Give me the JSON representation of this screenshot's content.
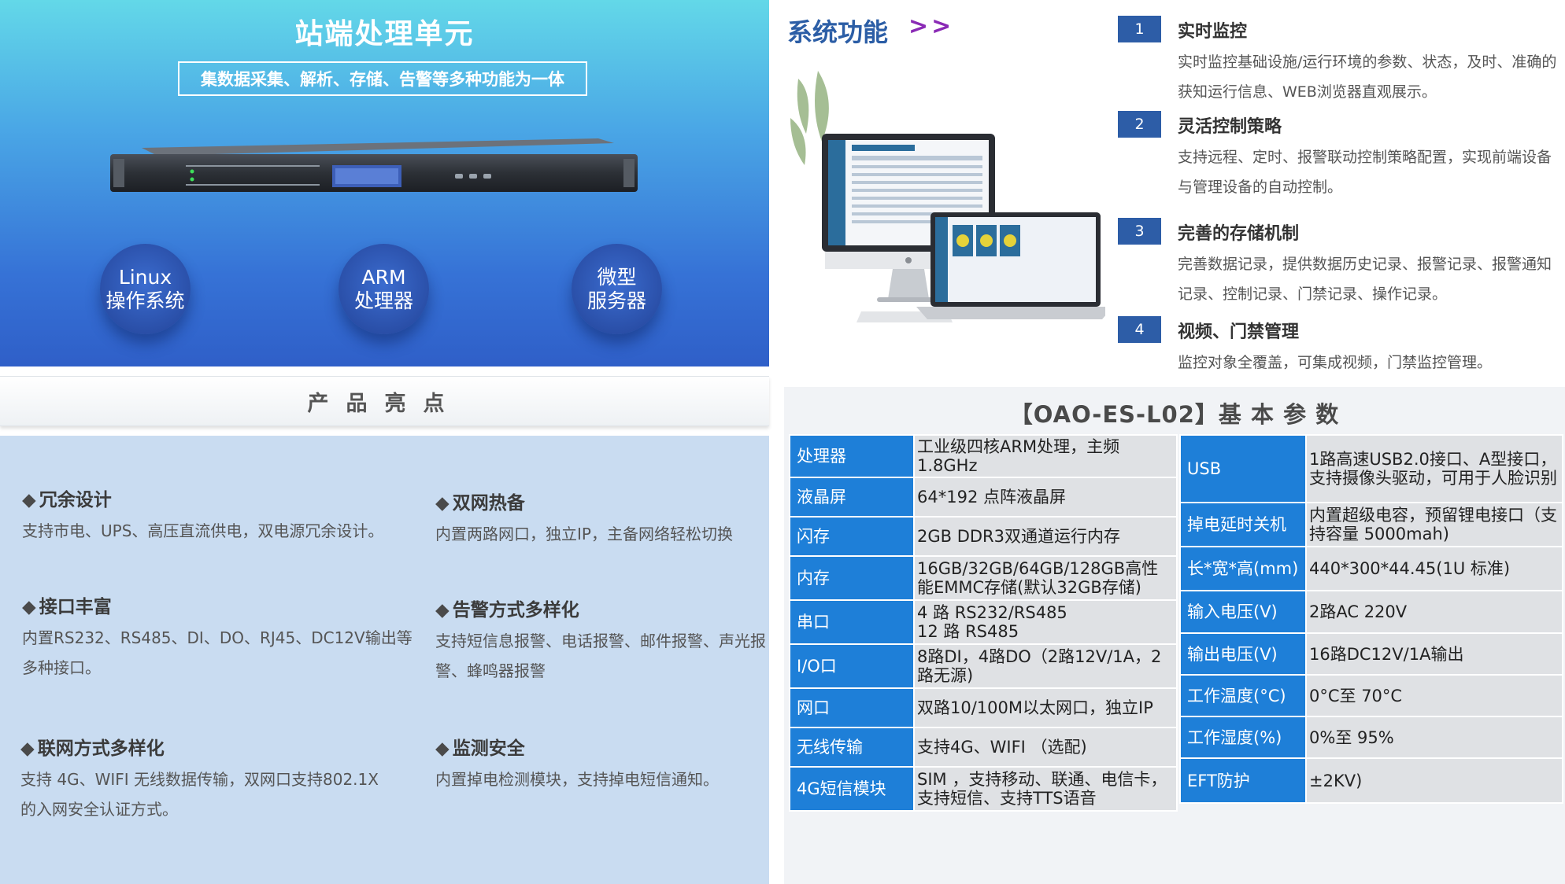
{
  "hero": {
    "title": "站端处理单元",
    "subtitle": "集数据采集、解析、存储、告警等多种功能为一体",
    "bubbles": [
      {
        "line1": "Linux",
        "line2": "操作系统"
      },
      {
        "line1": "ARM",
        "line2": "处理器"
      },
      {
        "line1": "微型",
        "line2": "服务器"
      }
    ]
  },
  "highlights": {
    "title": "产品亮点",
    "items": [
      {
        "title": "冗余设计",
        "desc": "支持市电、UPS、高压直流供电，双电源冗余设计。"
      },
      {
        "title": "双网热备",
        "desc": "内置两路网口，独立IP，主备网络轻松切换"
      },
      {
        "title": "接口丰富",
        "desc": "内置RS232、RS485、DI、DO、RJ45、DC12V输出等多种接口。"
      },
      {
        "title": "告警方式多样化",
        "desc": "支持短信息报警、电话报警、邮件报警、声光报警、蜂鸣器报警"
      },
      {
        "title": "联网方式多样化",
        "desc": "支持 4G、WIFI 无线数据传输，双网口支持802.1X 的入网安全认证方式。"
      },
      {
        "title": "监测安全",
        "desc": "内置掉电检测模块，支持掉电短信通知。"
      }
    ]
  },
  "functions": {
    "title": "系统功能",
    "arrows": ">>",
    "items": [
      {
        "num": "1",
        "title": "实时监控",
        "desc": "实时监控基础设施/运行环境的参数、状态，及时、准确的获知运行信息、WEB浏览器直观展示。"
      },
      {
        "num": "2",
        "title": "灵活控制策略",
        "desc": "支持远程、定时、报警联动控制策略配置，实现前端设备与管理设备的自动控制。"
      },
      {
        "num": "3",
        "title": "完善的存储机制",
        "desc": "完善数据记录，提供数据历史记录、报警记录、报警通知记录、控制记录、门禁记录、操作记录。"
      },
      {
        "num": "4",
        "title": "视频、门禁管理",
        "desc": "监控对象全覆盖，可集成视频，门禁监控管理。"
      }
    ]
  },
  "spec": {
    "title": "【OAO-ES-L02】基 本 参 数",
    "left": [
      {
        "k": "处理器",
        "v": "工业级四核ARM处理，主频1.8GHz"
      },
      {
        "k": "液晶屏",
        "v": "64*192 点阵液晶屏"
      },
      {
        "k": "闪存",
        "v": "2GB DDR3双通道运行内存"
      },
      {
        "k": "内存",
        "v": "16GB/32GB/64GB/128GB高性能EMMC存储(默认32GB存储)"
      },
      {
        "k": "串口",
        "v": "4 路 RS232/RS485\n12 路 RS485"
      },
      {
        "k": "I/O口",
        "v": "8路DI，4路DO（2路12V/1A，2路无源)"
      },
      {
        "k": "网口",
        "v": "双路10/100M以太网口，独立IP"
      },
      {
        "k": "无线传输",
        "v": "支持4G、WIFI （选配)"
      },
      {
        "k": "4G短信模块",
        "v": "SIM ，支持移动、联通、电信卡，支持短信、支持TTS语音"
      }
    ],
    "right": [
      {
        "k": "USB",
        "v": "1路高速USB2.0接口、A型接口，支持摄像头驱动，可用于人脸识别"
      },
      {
        "k": "掉电延时关机",
        "v": "内置超级电容，预留锂电接口（支持容量 5000mah)"
      },
      {
        "k": "长*宽*高(mm)",
        "v": "440*300*44.45(1U 标准)"
      },
      {
        "k": "输入电压(V)",
        "v": "2路AC 220V"
      },
      {
        "k": "输出电压(V)",
        "v": "16路DC12V/1A输出"
      },
      {
        "k": "工作温度(°C)",
        "v": "0°C至 70°C"
      },
      {
        "k": "工作湿度(%)",
        "v": "0%至 95%"
      },
      {
        "k": "EFT防护",
        "v": "±2KV)"
      }
    ]
  }
}
